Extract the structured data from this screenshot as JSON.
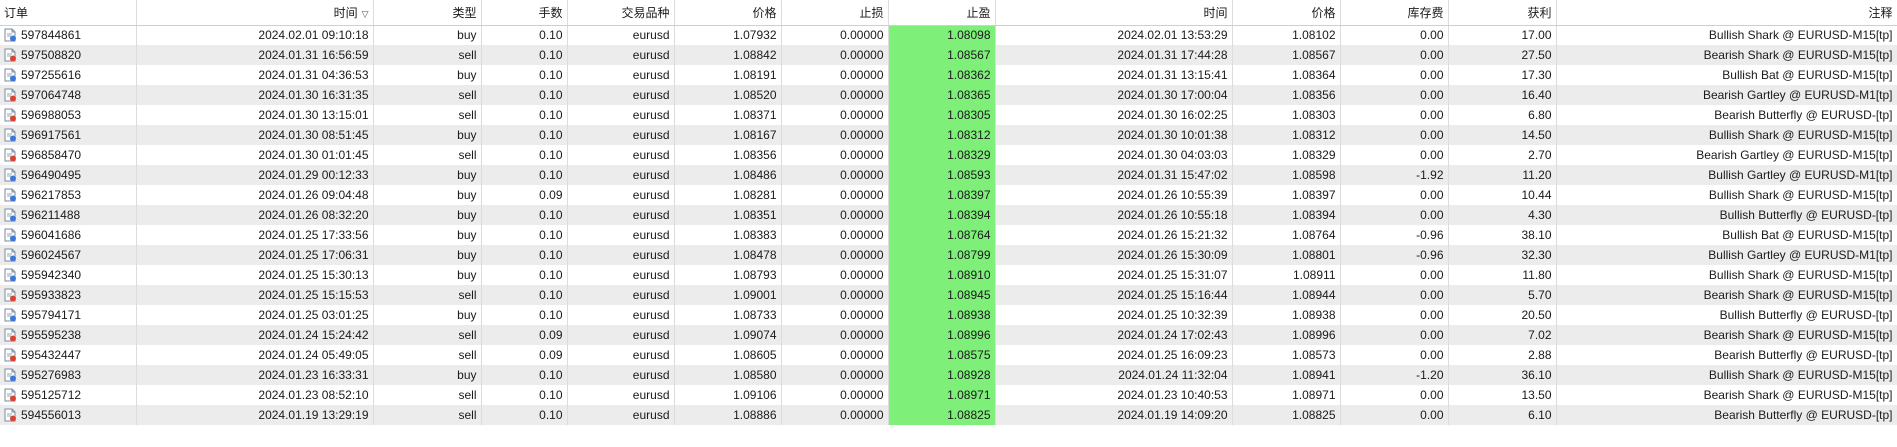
{
  "headers": {
    "ticket": "订单",
    "open_time": "时间",
    "sort_indicator": "▽",
    "type": "类型",
    "volume": "手数",
    "symbol": "交易品种",
    "open_price": "价格",
    "sl": "止损",
    "tp": "止盈",
    "close_time": "时间",
    "close_price": "价格",
    "swap": "库存费",
    "profit": "获利",
    "comment": "注释"
  },
  "colors": {
    "tp_highlight": "#7ef07a",
    "buy_icon": "#3b78d8",
    "sell_icon": "#d9432f"
  },
  "rows": [
    {
      "ticket": "597844861",
      "open_time": "2024.02.01 09:10:18",
      "type": "buy",
      "volume": "0.10",
      "symbol": "eurusd",
      "open_price": "1.07932",
      "sl": "0.00000",
      "tp": "1.08098",
      "close_time": "2024.02.01 13:53:29",
      "close_price": "1.08102",
      "swap": "0.00",
      "profit": "17.00",
      "comment": "Bullish Shark @ EURUSD-M15[tp]"
    },
    {
      "ticket": "597508820",
      "open_time": "2024.01.31 16:56:59",
      "type": "sell",
      "volume": "0.10",
      "symbol": "eurusd",
      "open_price": "1.08842",
      "sl": "0.00000",
      "tp": "1.08567",
      "close_time": "2024.01.31 17:44:28",
      "close_price": "1.08567",
      "swap": "0.00",
      "profit": "27.50",
      "comment": "Bearish Shark @ EURUSD-M15[tp]"
    },
    {
      "ticket": "597255616",
      "open_time": "2024.01.31 04:36:53",
      "type": "buy",
      "volume": "0.10",
      "symbol": "eurusd",
      "open_price": "1.08191",
      "sl": "0.00000",
      "tp": "1.08362",
      "close_time": "2024.01.31 13:15:41",
      "close_price": "1.08364",
      "swap": "0.00",
      "profit": "17.30",
      "comment": "Bullish Bat @ EURUSD-M15[tp]"
    },
    {
      "ticket": "597064748",
      "open_time": "2024.01.30 16:31:35",
      "type": "sell",
      "volume": "0.10",
      "symbol": "eurusd",
      "open_price": "1.08520",
      "sl": "0.00000",
      "tp": "1.08365",
      "close_time": "2024.01.30 17:00:04",
      "close_price": "1.08356",
      "swap": "0.00",
      "profit": "16.40",
      "comment": "Bearish Gartley @ EURUSD-M1[tp]"
    },
    {
      "ticket": "596988053",
      "open_time": "2024.01.30 13:15:01",
      "type": "sell",
      "volume": "0.10",
      "symbol": "eurusd",
      "open_price": "1.08371",
      "sl": "0.00000",
      "tp": "1.08305",
      "close_time": "2024.01.30 16:02:25",
      "close_price": "1.08303",
      "swap": "0.00",
      "profit": "6.80",
      "comment": "Bearish Butterfly @ EURUSD-[tp]"
    },
    {
      "ticket": "596917561",
      "open_time": "2024.01.30 08:51:45",
      "type": "buy",
      "volume": "0.10",
      "symbol": "eurusd",
      "open_price": "1.08167",
      "sl": "0.00000",
      "tp": "1.08312",
      "close_time": "2024.01.30 10:01:38",
      "close_price": "1.08312",
      "swap": "0.00",
      "profit": "14.50",
      "comment": "Bullish Shark @ EURUSD-M15[tp]"
    },
    {
      "ticket": "596858470",
      "open_time": "2024.01.30 01:01:45",
      "type": "sell",
      "volume": "0.10",
      "symbol": "eurusd",
      "open_price": "1.08356",
      "sl": "0.00000",
      "tp": "1.08329",
      "close_time": "2024.01.30 04:03:03",
      "close_price": "1.08329",
      "swap": "0.00",
      "profit": "2.70",
      "comment": "Bearish Gartley @ EURUSD-M15[tp]"
    },
    {
      "ticket": "596490495",
      "open_time": "2024.01.29 00:12:33",
      "type": "buy",
      "volume": "0.10",
      "symbol": "eurusd",
      "open_price": "1.08486",
      "sl": "0.00000",
      "tp": "1.08593",
      "close_time": "2024.01.31 15:47:02",
      "close_price": "1.08598",
      "swap": "-1.92",
      "profit": "11.20",
      "comment": "Bullish Gartley @ EURUSD-M1[tp]"
    },
    {
      "ticket": "596217853",
      "open_time": "2024.01.26 09:04:48",
      "type": "buy",
      "volume": "0.09",
      "symbol": "eurusd",
      "open_price": "1.08281",
      "sl": "0.00000",
      "tp": "1.08397",
      "close_time": "2024.01.26 10:55:39",
      "close_price": "1.08397",
      "swap": "0.00",
      "profit": "10.44",
      "comment": "Bullish Shark @ EURUSD-M15[tp]"
    },
    {
      "ticket": "596211488",
      "open_time": "2024.01.26 08:32:20",
      "type": "buy",
      "volume": "0.10",
      "symbol": "eurusd",
      "open_price": "1.08351",
      "sl": "0.00000",
      "tp": "1.08394",
      "close_time": "2024.01.26 10:55:18",
      "close_price": "1.08394",
      "swap": "0.00",
      "profit": "4.30",
      "comment": "Bullish Butterfly @ EURUSD-[tp]"
    },
    {
      "ticket": "596041686",
      "open_time": "2024.01.25 17:33:56",
      "type": "buy",
      "volume": "0.10",
      "symbol": "eurusd",
      "open_price": "1.08383",
      "sl": "0.00000",
      "tp": "1.08764",
      "close_time": "2024.01.26 15:21:32",
      "close_price": "1.08764",
      "swap": "-0.96",
      "profit": "38.10",
      "comment": "Bullish Bat @ EURUSD-M15[tp]"
    },
    {
      "ticket": "596024567",
      "open_time": "2024.01.25 17:06:31",
      "type": "buy",
      "volume": "0.10",
      "symbol": "eurusd",
      "open_price": "1.08478",
      "sl": "0.00000",
      "tp": "1.08799",
      "close_time": "2024.01.26 15:30:09",
      "close_price": "1.08801",
      "swap": "-0.96",
      "profit": "32.30",
      "comment": "Bullish Gartley @ EURUSD-M1[tp]"
    },
    {
      "ticket": "595942340",
      "open_time": "2024.01.25 15:30:13",
      "type": "buy",
      "volume": "0.10",
      "symbol": "eurusd",
      "open_price": "1.08793",
      "sl": "0.00000",
      "tp": "1.08910",
      "close_time": "2024.01.25 15:31:07",
      "close_price": "1.08911",
      "swap": "0.00",
      "profit": "11.80",
      "comment": "Bullish Shark @ EURUSD-M15[tp]"
    },
    {
      "ticket": "595933823",
      "open_time": "2024.01.25 15:15:53",
      "type": "sell",
      "volume": "0.10",
      "symbol": "eurusd",
      "open_price": "1.09001",
      "sl": "0.00000",
      "tp": "1.08945",
      "close_time": "2024.01.25 15:16:44",
      "close_price": "1.08944",
      "swap": "0.00",
      "profit": "5.70",
      "comment": "Bearish Shark @ EURUSD-M15[tp]"
    },
    {
      "ticket": "595794171",
      "open_time": "2024.01.25 03:01:25",
      "type": "buy",
      "volume": "0.10",
      "symbol": "eurusd",
      "open_price": "1.08733",
      "sl": "0.00000",
      "tp": "1.08938",
      "close_time": "2024.01.25 10:32:39",
      "close_price": "1.08938",
      "swap": "0.00",
      "profit": "20.50",
      "comment": "Bullish Butterfly @ EURUSD-[tp]"
    },
    {
      "ticket": "595595238",
      "open_time": "2024.01.24 15:24:42",
      "type": "sell",
      "volume": "0.09",
      "symbol": "eurusd",
      "open_price": "1.09074",
      "sl": "0.00000",
      "tp": "1.08996",
      "close_time": "2024.01.24 17:02:43",
      "close_price": "1.08996",
      "swap": "0.00",
      "profit": "7.02",
      "comment": "Bearish Shark @ EURUSD-M15[tp]"
    },
    {
      "ticket": "595432447",
      "open_time": "2024.01.24 05:49:05",
      "type": "sell",
      "volume": "0.09",
      "symbol": "eurusd",
      "open_price": "1.08605",
      "sl": "0.00000",
      "tp": "1.08575",
      "close_time": "2024.01.25 16:09:23",
      "close_price": "1.08573",
      "swap": "0.00",
      "profit": "2.88",
      "comment": "Bearish Butterfly @ EURUSD-[tp]"
    },
    {
      "ticket": "595276983",
      "open_time": "2024.01.23 16:33:31",
      "type": "buy",
      "volume": "0.10",
      "symbol": "eurusd",
      "open_price": "1.08580",
      "sl": "0.00000",
      "tp": "1.08928",
      "close_time": "2024.01.24 11:32:04",
      "close_price": "1.08941",
      "swap": "-1.20",
      "profit": "36.10",
      "comment": "Bullish Shark @ EURUSD-M15[tp]"
    },
    {
      "ticket": "595125712",
      "open_time": "2024.01.23 08:52:10",
      "type": "sell",
      "volume": "0.10",
      "symbol": "eurusd",
      "open_price": "1.09106",
      "sl": "0.00000",
      "tp": "1.08971",
      "close_time": "2024.01.23 10:40:53",
      "close_price": "1.08971",
      "swap": "0.00",
      "profit": "13.50",
      "comment": "Bearish Shark @ EURUSD-M15[tp]"
    },
    {
      "ticket": "594556013",
      "open_time": "2024.01.19 13:29:19",
      "type": "sell",
      "volume": "0.10",
      "symbol": "eurusd",
      "open_price": "1.08886",
      "sl": "0.00000",
      "tp": "1.08825",
      "close_time": "2024.01.19 14:09:20",
      "close_price": "1.08825",
      "swap": "0.00",
      "profit": "6.10",
      "comment": "Bearish Butterfly @ EURUSD-[tp]"
    }
  ]
}
